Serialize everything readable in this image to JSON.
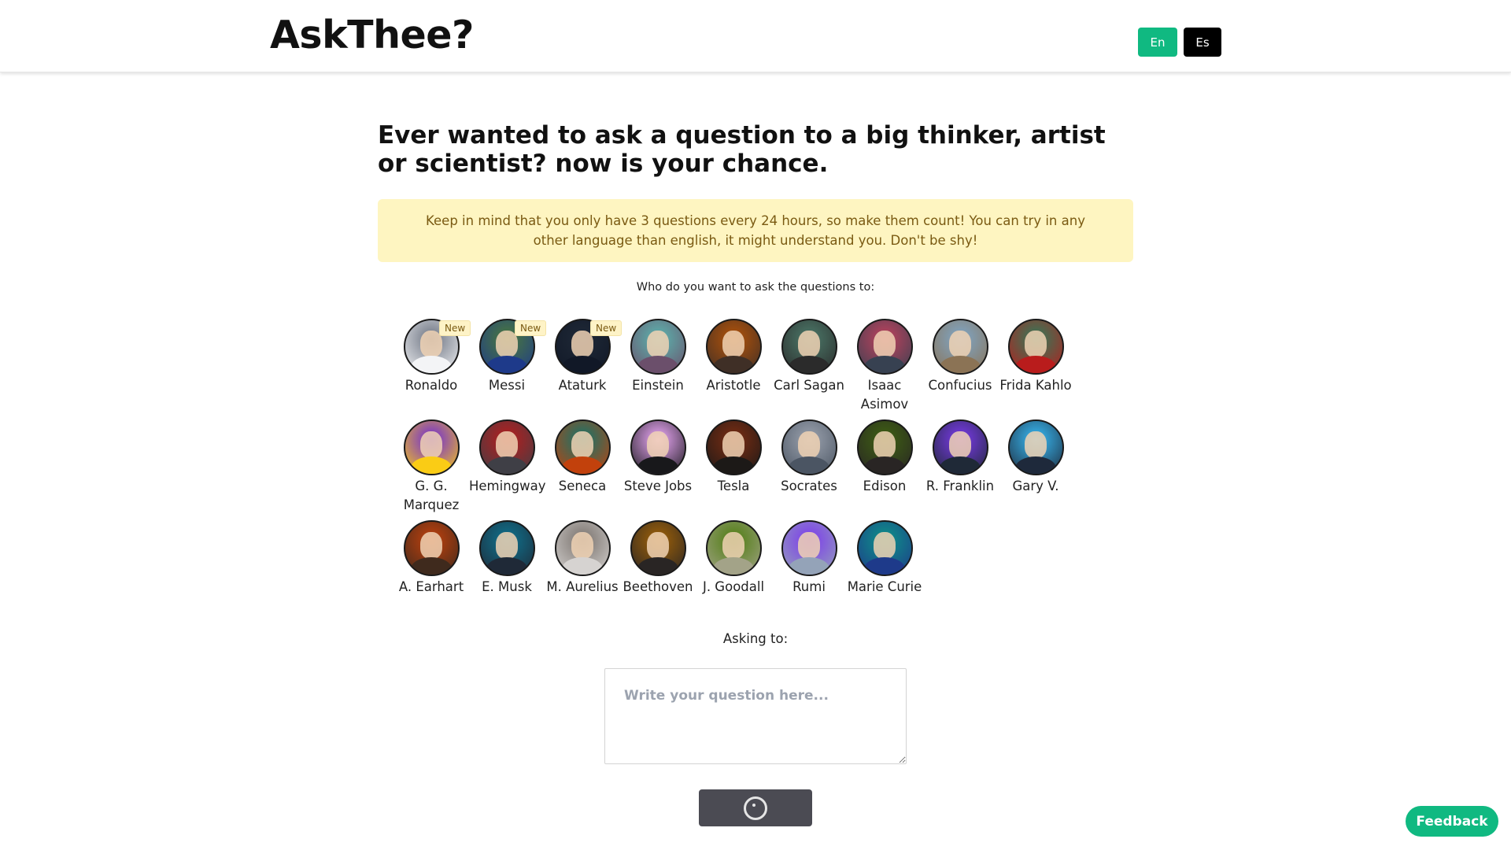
{
  "header": {
    "logo": "AskThee?",
    "lang_en": "En",
    "lang_es": "Es"
  },
  "headline": "Ever wanted to ask a question to a big thinker, artist or scientist? now is your chance.",
  "notice": "Keep in mind that you only have 3 questions every 24 hours, so make them count!  You can try in any other language than english, it might understand you. Don't be shy!",
  "who_label": "Who do you want to ask the questions to:",
  "people": [
    {
      "name": "Ronaldo",
      "badge": "New",
      "bg": "#6b7280",
      "accent": "#f3f4f6"
    },
    {
      "name": "Messi",
      "badge": "New",
      "bg": "#4b7a3a",
      "accent": "#1e3a8a"
    },
    {
      "name": "Ataturk",
      "badge": "New",
      "bg": "#1f2937",
      "accent": "#111827"
    },
    {
      "name": "Einstein",
      "badge": "",
      "bg": "#5bb7b0",
      "accent": "#6b4f6b"
    },
    {
      "name": "Aristotle",
      "badge": "",
      "bg": "#b45309",
      "accent": "#3f2f26"
    },
    {
      "name": "Carl Sagan",
      "badge": "",
      "bg": "#4c7a6a",
      "accent": "#2b2b2b"
    },
    {
      "name": "Isaac Asimov",
      "badge": "",
      "bg": "#c2415d",
      "accent": "#374151"
    },
    {
      "name": "Confucius",
      "badge": "",
      "bg": "#7ea7c9",
      "accent": "#8b7355"
    },
    {
      "name": "Frida Kahlo",
      "badge": "",
      "bg": "#2e7d5b",
      "accent": "#b91c1c"
    },
    {
      "name": "G. G. Marquez",
      "badge": "",
      "bg": "#6d28d9",
      "accent": "#facc15"
    },
    {
      "name": "Hemingway",
      "badge": "",
      "bg": "#b91c1c",
      "accent": "#3f3f46"
    },
    {
      "name": "Seneca",
      "badge": "",
      "bg": "#0f766e",
      "accent": "#c2410c"
    },
    {
      "name": "Steve Jobs",
      "badge": "",
      "bg": "#f0abfc",
      "accent": "#18181b"
    },
    {
      "name": "Tesla",
      "badge": "",
      "bg": "#7c2d12",
      "accent": "#1c1917"
    },
    {
      "name": "Socrates",
      "badge": "",
      "bg": "#9ca3af",
      "accent": "#4b5563"
    },
    {
      "name": "Edison",
      "badge": "",
      "bg": "#3f6212",
      "accent": "#292524"
    },
    {
      "name": "R. Franklin",
      "badge": "",
      "bg": "#7c3aed",
      "accent": "#1f2937"
    },
    {
      "name": "Gary V.",
      "badge": "",
      "bg": "#38bdf8",
      "accent": "#1e293b"
    },
    {
      "name": "A. Earhart",
      "badge": "",
      "bg": "#c2410c",
      "accent": "#3f2a1d"
    },
    {
      "name": "E. Musk",
      "badge": "",
      "bg": "#0e7490",
      "accent": "#1f2937"
    },
    {
      "name": "M. Aurelius",
      "badge": "",
      "bg": "#78716c",
      "accent": "#d6d3d1"
    },
    {
      "name": "Beethoven",
      "badge": "",
      "bg": "#a16207",
      "accent": "#292524"
    },
    {
      "name": "J. Goodall",
      "badge": "",
      "bg": "#4d7c0f",
      "accent": "#a3a388"
    },
    {
      "name": "Rumi",
      "badge": "",
      "bg": "#7c3aed",
      "accent": "#94a3b8"
    },
    {
      "name": "Marie Curie",
      "badge": "",
      "bg": "#0d9488",
      "accent": "#1e3a8a"
    }
  ],
  "asking_to": "Asking to:",
  "question_placeholder": "Write your question here...",
  "feedback": "Feedback"
}
